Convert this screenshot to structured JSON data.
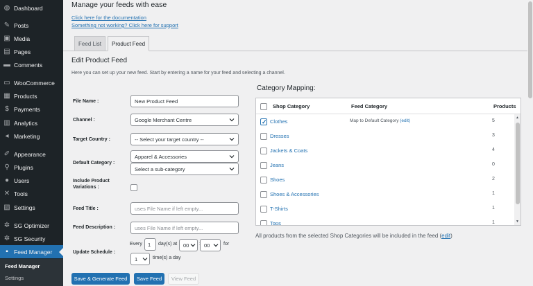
{
  "sidebar": {
    "items": [
      {
        "label": "Dashboard",
        "icon": "dashboard-icon",
        "glyph": "◍"
      },
      {
        "label": "Posts",
        "icon": "pin-icon",
        "glyph": "✎"
      },
      {
        "label": "Media",
        "icon": "media-icon",
        "glyph": "▣"
      },
      {
        "label": "Pages",
        "icon": "pages-icon",
        "glyph": "▤"
      },
      {
        "label": "Comments",
        "icon": "comments-icon",
        "glyph": "▬"
      },
      {
        "label": "WooCommerce",
        "icon": "woocommerce-icon",
        "glyph": "▭"
      },
      {
        "label": "Products",
        "icon": "products-icon",
        "glyph": "▦"
      },
      {
        "label": "Payments",
        "icon": "payments-icon",
        "glyph": "$"
      },
      {
        "label": "Analytics",
        "icon": "analytics-icon",
        "glyph": "▥"
      },
      {
        "label": "Marketing",
        "icon": "marketing-icon",
        "glyph": "◂"
      },
      {
        "label": "Appearance",
        "icon": "appearance-icon",
        "glyph": "✐"
      },
      {
        "label": "Plugins",
        "icon": "plugins-icon",
        "glyph": "⚲"
      },
      {
        "label": "Users",
        "icon": "users-icon",
        "glyph": "●"
      },
      {
        "label": "Tools",
        "icon": "tools-icon",
        "glyph": "✕"
      },
      {
        "label": "Settings",
        "icon": "settings-icon",
        "glyph": "▧"
      },
      {
        "label": "SG Optimizer",
        "icon": "sg-optimizer-icon",
        "glyph": "✲"
      },
      {
        "label": "SG Security",
        "icon": "sg-security-icon",
        "glyph": "✲"
      },
      {
        "label": "Feed Manager",
        "icon": "feed-manager-icon",
        "glyph": "▪"
      }
    ],
    "submenu": [
      "Feed Manager",
      "Settings"
    ]
  },
  "header": {
    "title": "Manage your feeds with ease",
    "doc_link": "Click here for the documentation",
    "support_link": "Something not working? Click here for support"
  },
  "tabs": [
    "Feed List",
    "Product Feed"
  ],
  "form": {
    "section_title": "Edit Product Feed",
    "section_desc": "Here you can set up your new feed. Start by entering a name for your feed and selecting a channel.",
    "file_name_label": "File Name :",
    "file_name_value": "New Product Feed",
    "channel_label": "Channel :",
    "channel_value": "Google Merchant Centre",
    "target_country_label": "Target Country :",
    "target_country_value": "-- Select your target country --",
    "default_category_label": "Default Category :",
    "default_category_value": "Apparel & Accessories",
    "sub_category_value": "Select a sub-category",
    "include_variations_label": "Include Product Variations :",
    "feed_title_label": "Feed Title :",
    "feed_title_placeholder": "uses File Name if left empty...",
    "feed_desc_label": "Feed Description :",
    "feed_desc_placeholder": "uses File Name if left empty...",
    "update_schedule_label": "Update Schedule :",
    "every_text": "Every",
    "every_value": "1",
    "days_at_text": "day(s) at",
    "hour_value": "00",
    "minute_value": "00",
    "for_text": "for",
    "times_value": "1",
    "times_text": "time(s) a day"
  },
  "buttons": {
    "save_generate": "Save & Generate Feed",
    "save": "Save Feed",
    "view": "View Feed"
  },
  "category_mapping": {
    "title": "Category Mapping:",
    "headers": {
      "shop": "Shop Category",
      "feed": "Feed Category",
      "products": "Products"
    },
    "rows": [
      {
        "name": "Clothes",
        "count": "5",
        "checked": true,
        "map_text": "Map to Default Category",
        "edit": "(edit)"
      },
      {
        "name": "Dresses",
        "count": "3"
      },
      {
        "name": "Jackets & Coats",
        "count": "4"
      },
      {
        "name": "Jeans",
        "count": "0"
      },
      {
        "name": "Shoes",
        "count": "2"
      },
      {
        "name": "Shoes & Accessories",
        "count": "1"
      },
      {
        "name": "T-Shirts",
        "count": "1"
      },
      {
        "name": "Tops",
        "count": "1"
      }
    ],
    "footer_text": "All products from the selected Shop Categories will be included in the feed",
    "footer_edit": "edit"
  },
  "colors": {
    "accent": "#2271b1",
    "sidebar_bg": "#1d2327",
    "page_bg": "#f0f0f1"
  }
}
